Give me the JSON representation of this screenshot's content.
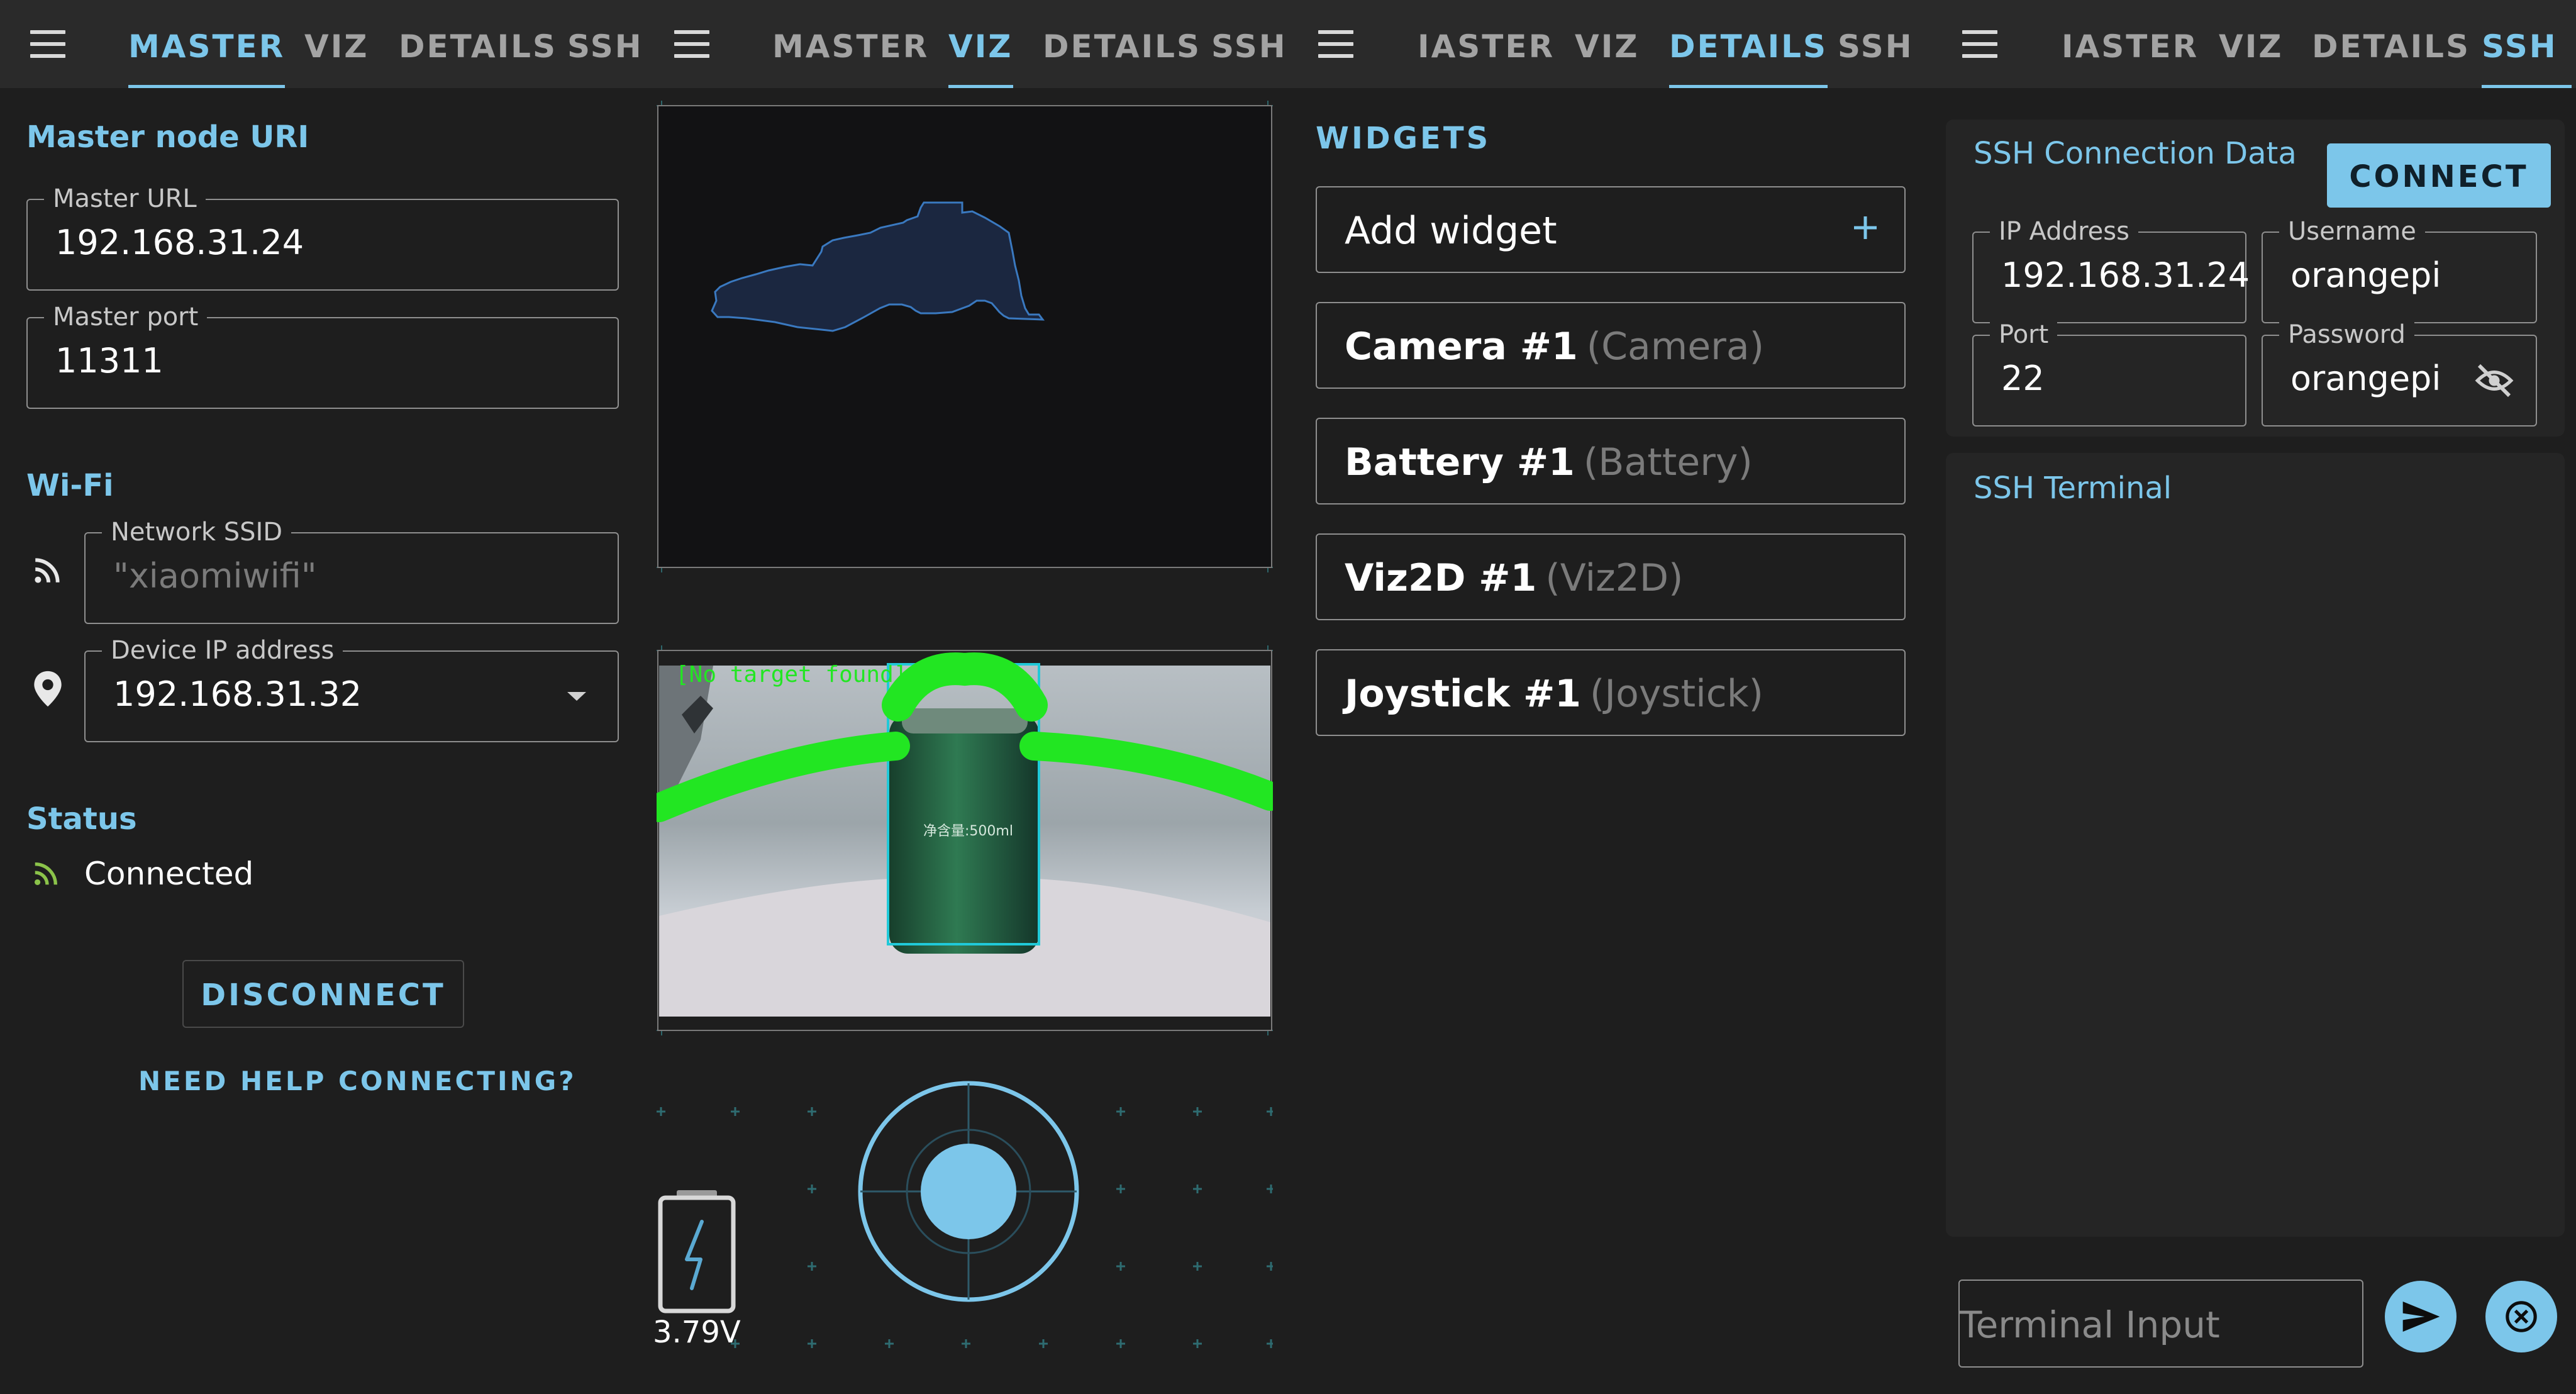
{
  "tabs": [
    "MASTER",
    "VIZ",
    "DETAILS",
    "SSH"
  ],
  "clipped_tabs": {
    "details_view": "IASTER",
    "ssh_view": "IASTER"
  },
  "colors": {
    "accent": "#7cc6ea",
    "background": "#1e1e1e",
    "toolbar": "#2a2a2a",
    "status_ok": "#8bc34a",
    "detection_green": "#22e622"
  },
  "master": {
    "node_title": "Master node URI",
    "url_label": "Master URL",
    "url_value": "192.168.31.24",
    "port_label": "Master port",
    "port_value": "11311",
    "wifi_title": "Wi-Fi",
    "ssid_label": "Network SSID",
    "ssid_placeholder": "\"xiaomiwifi\"",
    "ip_label": "Device IP address",
    "ip_value": "192.168.31.32",
    "status_title": "Status",
    "status_value": "Connected",
    "disconnect_label": "DISCONNECT",
    "help_label": "NEED HELP CONNECTING?",
    "icons": [
      "rss-feed-icon",
      "location-pin-icon",
      "dropdown-arrow-icon",
      "wifi-status-icon"
    ]
  },
  "viz": {
    "camera_overlay_text": "[No target found]",
    "can_label_text": "净含量:500ml",
    "battery_voltage": "3.79V",
    "icons": [
      "battery-charging-icon",
      "joystick-icon"
    ]
  },
  "details": {
    "title": "WIDGETS",
    "add_label": "Add widget",
    "widgets": [
      {
        "name": "Camera #1",
        "type": "(Camera)"
      },
      {
        "name": "Battery #1",
        "type": "(Battery)"
      },
      {
        "name": "Viz2D #1",
        "type": "(Viz2D)"
      },
      {
        "name": "Joystick #1",
        "type": "(Joystick)"
      }
    ]
  },
  "ssh": {
    "title": "SSH Connection Data",
    "connect_label": "CONNECT",
    "ip_label": "IP Address",
    "ip_value": "192.168.31.24",
    "user_label": "Username",
    "user_value": "orangepi",
    "port_label": "Port",
    "port_value": "22",
    "password_label": "Password",
    "password_value": "orangepi",
    "terminal_title": "SSH Terminal",
    "terminal_placeholder": "Terminal Input",
    "icons": [
      "eye-off-icon",
      "send-icon",
      "close-circle-icon"
    ]
  }
}
